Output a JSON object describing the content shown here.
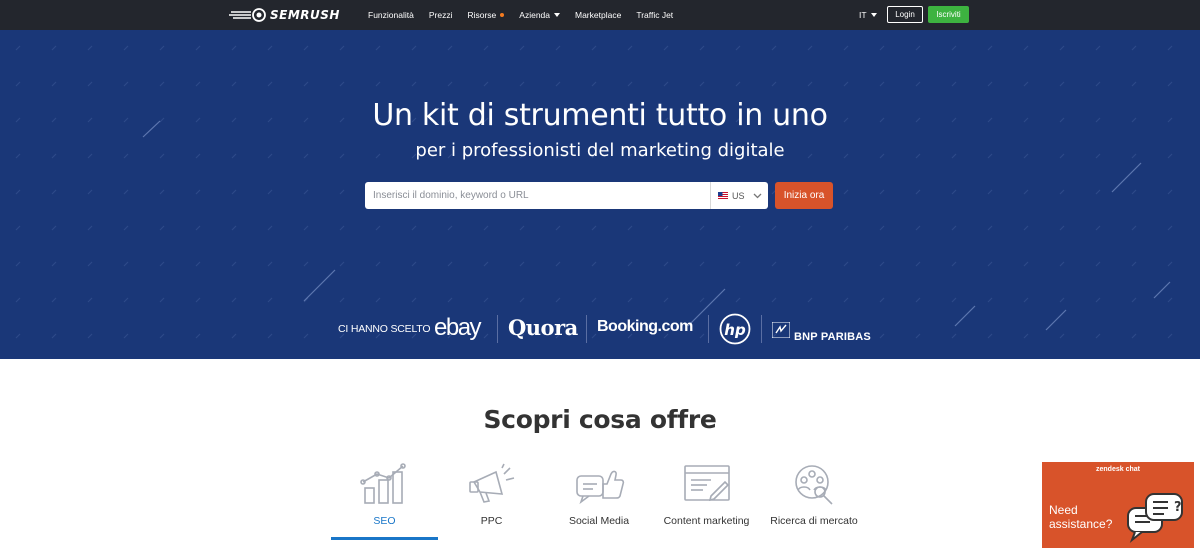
{
  "header": {
    "logo_text": "SEMRUSH",
    "nav": [
      {
        "label": "Funzionalità"
      },
      {
        "label": "Prezzi"
      },
      {
        "label": "Risorse"
      },
      {
        "label": "Azienda"
      },
      {
        "label": "Marketplace"
      },
      {
        "label": "Traffic Jet"
      }
    ],
    "language": "IT",
    "login_label": "Login",
    "signup_label": "Iscriviti"
  },
  "hero": {
    "title": "Un kit di strumenti tutto in uno",
    "subtitle": "per i professionisti del marketing digitale",
    "search_placeholder": "Inserisci il dominio, keyword o URL",
    "search_value": "",
    "country": "US",
    "start_label": "Inizia ora",
    "clients_label": "CI HANNO SCELTO",
    "clients": {
      "ebay": "ebay",
      "quora": "Quora",
      "booking": "Booking.com",
      "hp": "hp",
      "bnp": "BNP PARIBAS"
    }
  },
  "offer": {
    "title": "Scopri cosa offre",
    "tabs": [
      {
        "label": "SEO",
        "icon": "seo-chart-icon",
        "active": true
      },
      {
        "label": "PPC",
        "icon": "megaphone-icon",
        "active": false
      },
      {
        "label": "Social Media",
        "icon": "social-thumbs-up-icon",
        "active": false
      },
      {
        "label": "Content marketing",
        "icon": "content-edit-icon",
        "active": false
      },
      {
        "label": "Ricerca di mercato",
        "icon": "market-research-icon",
        "active": false
      }
    ]
  },
  "chat": {
    "brand": "zendesk chat",
    "text": "Need assistance?"
  },
  "colors": {
    "topbar": "#23262d",
    "hero": "#1a3778",
    "accent_orange": "#d8532a",
    "signup_green": "#3db340",
    "active_tab": "#1976c8"
  }
}
